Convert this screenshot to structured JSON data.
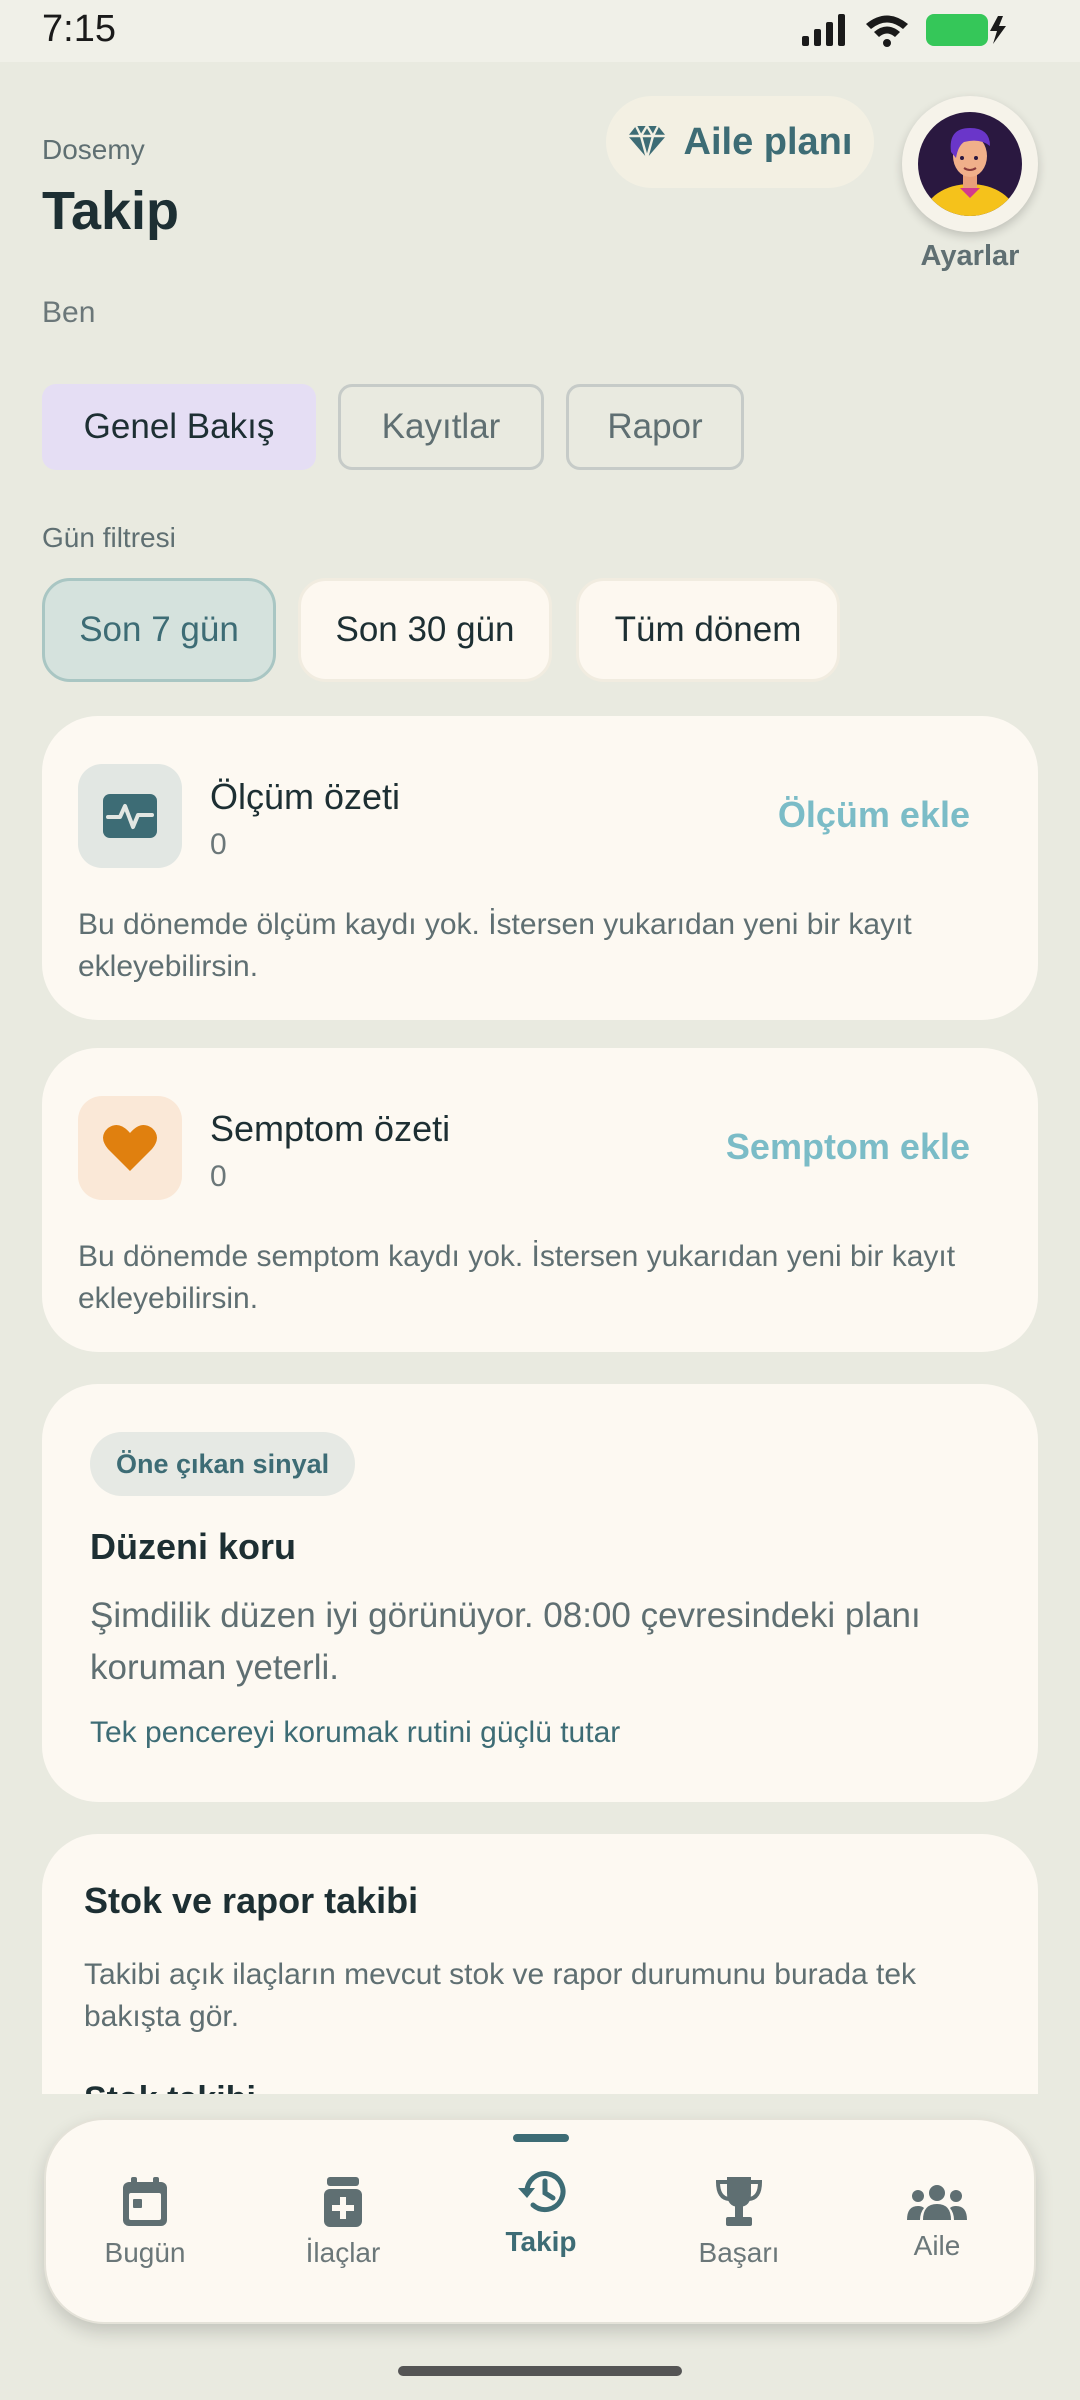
{
  "status_bar": {
    "time": "7:15"
  },
  "header": {
    "app_name": "Dosemy",
    "title": "Takip",
    "profile": "Ben",
    "family_plan_label": "Aile planı",
    "settings_label": "Ayarlar"
  },
  "tabs": [
    {
      "label": "Genel Bakış",
      "active": true
    },
    {
      "label": "Kayıtlar",
      "active": false
    },
    {
      "label": "Rapor",
      "active": false
    }
  ],
  "filter": {
    "label": "Gün filtresi",
    "options": [
      {
        "label": "Son 7 gün",
        "selected": true
      },
      {
        "label": "Son 30 gün",
        "selected": false
      },
      {
        "label": "Tüm dönem",
        "selected": false
      }
    ]
  },
  "measurement": {
    "title": "Ölçüm özeti",
    "count": "0",
    "action": "Ölçüm ekle",
    "empty_text": "Bu dönemde ölçüm kaydı yok. İstersen yukarıdan yeni bir kayıt ekleyebilirsin.",
    "icon": "pulse-icon"
  },
  "symptom": {
    "title": "Semptom özeti",
    "count": "0",
    "action": "Semptom ekle",
    "empty_text": "Bu dönemde semptom kaydı yok. İstersen yukarıdan yeni bir kayıt ekleyebilirsin.",
    "icon": "heart-icon"
  },
  "signal": {
    "badge": "Öne çıkan sinyal",
    "title": "Düzeni koru",
    "text": "Şimdilik düzen iyi görünüyor. 08:00 çevresindeki planı koruman yeterli.",
    "note": "Tek pencereyi korumak rutini güçlü tutar"
  },
  "stock": {
    "title": "Stok ve rapor takibi",
    "text": "Takibi açık ilaçların mevcut stok ve rapor durumunu burada tek bakışta gör.",
    "subtitle_partial": "Stok takibi"
  },
  "nav": [
    {
      "label": "Bugün",
      "icon": "calendar-icon"
    },
    {
      "label": "İlaçlar",
      "icon": "pill-bottle-icon"
    },
    {
      "label": "Takip",
      "icon": "history-icon",
      "active": true
    },
    {
      "label": "Başarı",
      "icon": "trophy-icon"
    },
    {
      "label": "Aile",
      "icon": "family-icon"
    }
  ],
  "colors": {
    "background": "#e9eae0",
    "card": "#fdf9f2",
    "accent": "#3d6c75",
    "action": "#7bbcc7",
    "active_tab": "#e5def4",
    "heart": "#e0800f"
  }
}
